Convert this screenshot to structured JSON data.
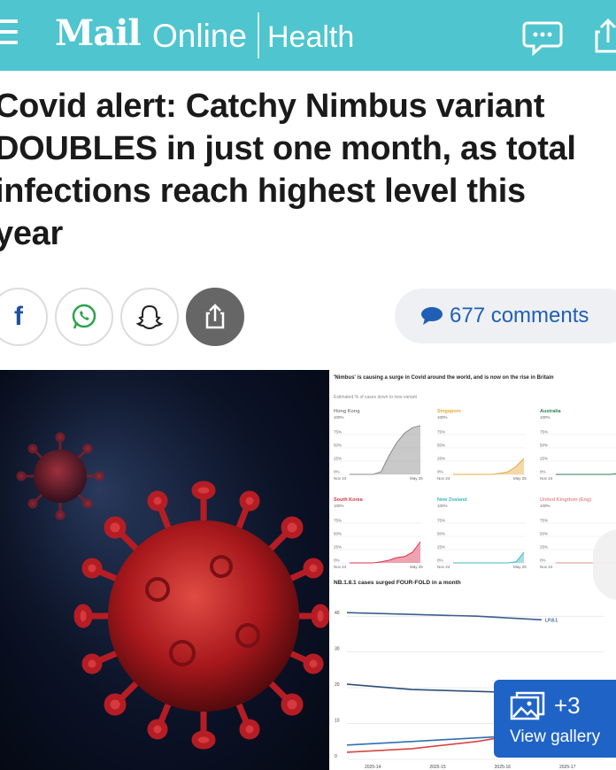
{
  "header": {
    "logo_bold": "Mail",
    "logo_light": "Online",
    "section": "Health",
    "menu_icon": "hamburger-menu-icon",
    "comment_icon": "speech-bubble-icon",
    "share_icon": "share-icon",
    "bg_color": "#4ec5cf"
  },
  "article": {
    "headline_lines": [
      "Covid alert: Catchy Nimbus variant",
      "DOUBLES in just one month, as total",
      "infections reach highest level this",
      "year"
    ]
  },
  "share": {
    "facebook_glyph": "f",
    "facebook_icon": "facebook-icon",
    "whatsapp_icon": "whatsapp-icon",
    "snapchat_icon": "snapchat-icon",
    "share_icon": "share-icon"
  },
  "comments": {
    "label": "677 comments",
    "color": "#1f5fb5"
  },
  "figure": {
    "title": "'Nimbus' is causing a surge in Covid around the world, and is now on the rise in Britain",
    "subtitle": "Estimated % of cases down to new variant",
    "panels": [
      {
        "name": "Hong Kong",
        "color": "#888888",
        "x_start": "Nov 24",
        "x_end": "May 25"
      },
      {
        "name": "Singapore",
        "color": "#e7a93c",
        "x_start": "Nov 24",
        "x_end": "May 25"
      },
      {
        "name": "Australia",
        "color": "#2e7d4f",
        "x_start": "Nov 24",
        "x_end": "M"
      },
      {
        "name": "South Korea",
        "color": "#d9334f",
        "x_start": "Nov 24",
        "x_end": "May 25"
      },
      {
        "name": "New Zealand",
        "color": "#3fb7c6",
        "x_start": "Nov 24",
        "x_end": "May 25"
      },
      {
        "name": "United Kingdom (Eng)",
        "color": "#e58f8f",
        "x_start": "Nov 24",
        "x_end": ""
      }
    ],
    "panel_ticks": [
      "100%",
      "75%",
      "50%",
      "25%",
      "0%"
    ],
    "panel_top_tick": "100%",
    "bottom_title": "NB.1.8.1 cases surged FOUR-FOLD in a month",
    "bottom_y_ticks": [
      "40",
      "30",
      "20",
      "10",
      "0"
    ],
    "bottom_x_ticks": [
      "2025-14",
      "2025-15",
      "2025-16",
      "2025-17"
    ],
    "bottom_series_label": "LP.8.1"
  },
  "gallery": {
    "count": "+3",
    "label": "View gallery",
    "icon": "gallery-photos-icon",
    "color": "#1f63c6"
  },
  "chart_data": [
    {
      "type": "area",
      "title": "Hong Kong",
      "x": [
        "Nov 24",
        "May 25"
      ],
      "ylim": [
        0,
        100
      ],
      "values": [
        0,
        0,
        0,
        0,
        5,
        35,
        60,
        78,
        88,
        92
      ]
    },
    {
      "type": "area",
      "title": "Singapore",
      "x": [
        "Nov 24",
        "May 25"
      ],
      "ylim": [
        0,
        100
      ],
      "values": [
        0,
        0,
        0,
        0,
        0,
        0,
        2,
        5,
        15,
        30
      ]
    },
    {
      "type": "area",
      "title": "Australia",
      "x": [
        "Nov 24",
        "M"
      ],
      "ylim": [
        0,
        100
      ],
      "values": [
        0,
        0,
        0,
        0,
        0,
        0,
        0,
        0,
        2,
        5
      ]
    },
    {
      "type": "area",
      "title": "South Korea",
      "x": [
        "Nov 24",
        "May 25"
      ],
      "ylim": [
        0,
        100
      ],
      "values": [
        0,
        0,
        0,
        0,
        2,
        5,
        10,
        12,
        20,
        40
      ]
    },
    {
      "type": "area",
      "title": "New Zealand",
      "x": [
        "Nov 24",
        "May 25"
      ],
      "ylim": [
        0,
        100
      ],
      "values": [
        0,
        0,
        0,
        0,
        0,
        0,
        0,
        0,
        2,
        20
      ]
    },
    {
      "type": "area",
      "title": "United Kingdom (Eng)",
      "x": [
        "Nov 24"
      ],
      "ylim": [
        0,
        100
      ],
      "values": [
        0,
        0,
        0,
        0,
        0,
        0,
        0,
        0,
        0,
        2
      ]
    },
    {
      "type": "line",
      "title": "NB.1.8.1 cases surged FOUR-FOLD in a month",
      "x": [
        "2025-14",
        "2025-15",
        "2025-16",
        "2025-17"
      ],
      "ylim": [
        0,
        45
      ],
      "series": [
        {
          "name": "LP.8.1",
          "color": "#3a5f8f",
          "values": [
            41,
            40.5,
            40,
            39
          ]
        },
        {
          "color": "#2c4f7a",
          "values": [
            21,
            19.5,
            19,
            18.5
          ]
        },
        {
          "color": "#2f6fb0",
          "values": [
            4,
            5,
            6,
            7
          ]
        },
        {
          "color": "#d9443f",
          "values": [
            2,
            3,
            5,
            8
          ]
        }
      ]
    }
  ]
}
